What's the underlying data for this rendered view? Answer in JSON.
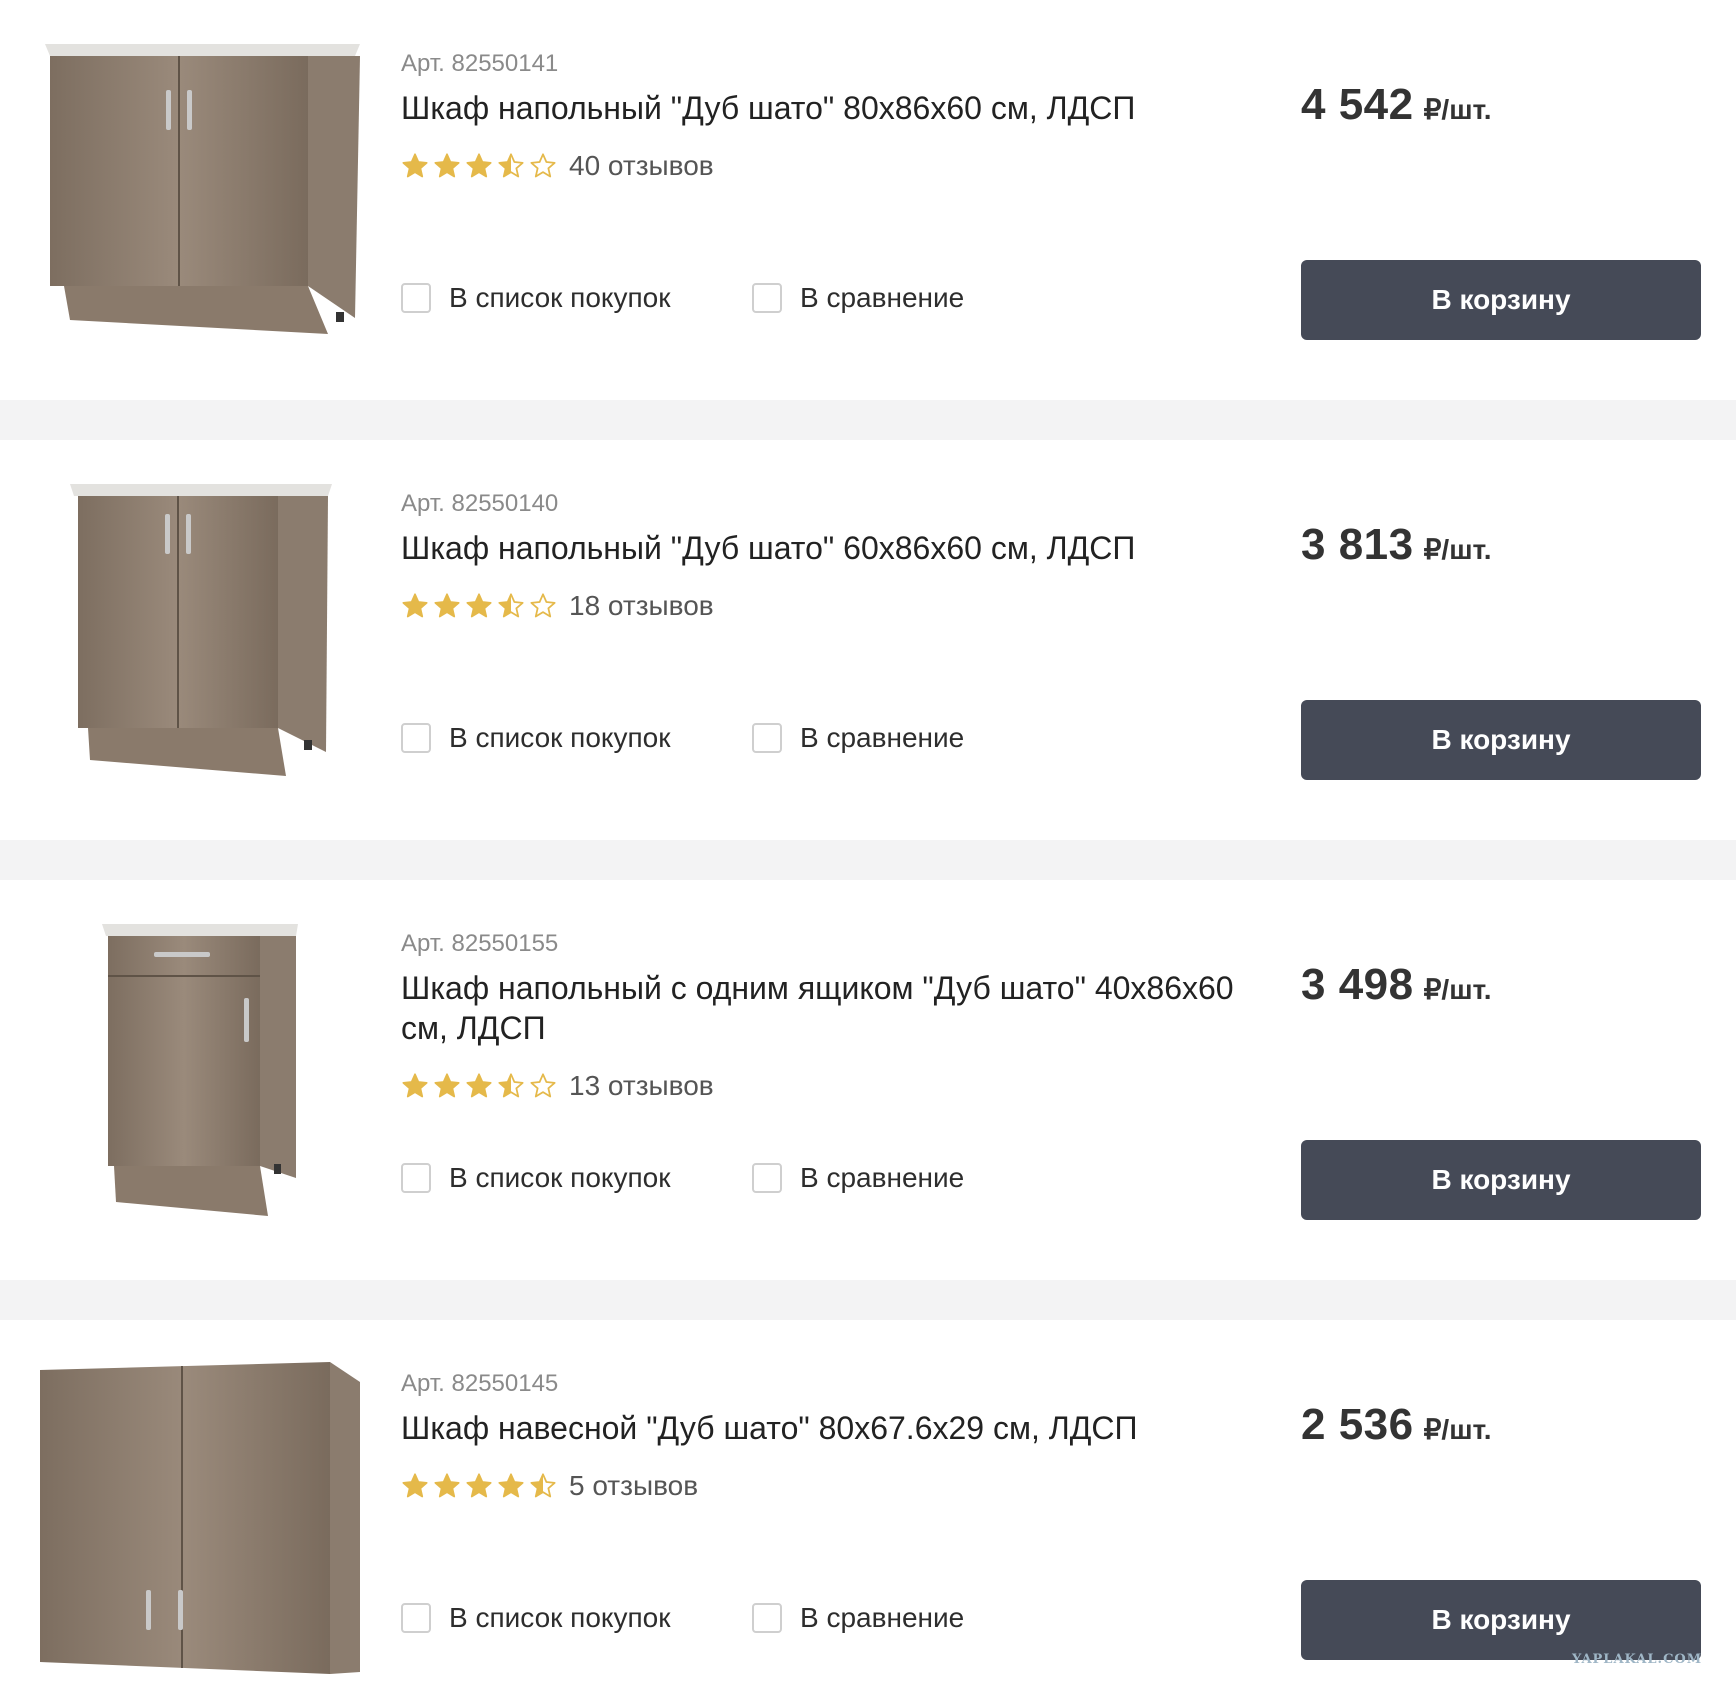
{
  "colors": {
    "page_background": "#f3f3f4",
    "card_background": "#ffffff",
    "button_background": "#454a57",
    "button_text": "#ffffff",
    "star_filled": "#e5b94a",
    "star_empty_outline": "#e5b94a",
    "sku_text": "#8a8a8a"
  },
  "products": [
    {
      "sku": "Арт. 82550141",
      "title": "Шкаф напольный \"Дуб шато\" 80x86x60 см, ЛДСП",
      "rating": 3.5,
      "reviews": "40 отзывов",
      "price": "4 542",
      "price_unit": "₽/шт.",
      "shopping_list_label": "В список покупок",
      "compare_label": "В сравнение",
      "cart_label": "В корзину",
      "image_icon": "floor-cabinet-two-doors"
    },
    {
      "sku": "Арт. 82550140",
      "title": "Шкаф напольный \"Дуб шато\" 60x86x60 см, ЛДСП",
      "rating": 3.5,
      "reviews": "18 отзывов",
      "price": "3 813",
      "price_unit": "₽/шт.",
      "shopping_list_label": "В список покупок",
      "compare_label": "В сравнение",
      "cart_label": "В корзину",
      "image_icon": "floor-cabinet-two-doors"
    },
    {
      "sku": "Арт. 82550155",
      "title": "Шкаф напольный с одним ящиком \"Дуб шато\" 40x86x60 см, ЛДСП",
      "rating": 3.5,
      "reviews": "13 отзывов",
      "price": "3 498",
      "price_unit": "₽/шт.",
      "shopping_list_label": "В список покупок",
      "compare_label": "В сравнение",
      "cart_label": "В корзину",
      "image_icon": "floor-cabinet-drawer"
    },
    {
      "sku": "Арт. 82550145",
      "title": "Шкаф навесной \"Дуб шато\" 80x67.6x29 см, ЛДСП",
      "rating": 4.5,
      "reviews": "5 отзывов",
      "price": "2 536",
      "price_unit": "₽/шт.",
      "shopping_list_label": "В список покупок",
      "compare_label": "В сравнение",
      "cart_label": "В корзину",
      "image_icon": "wall-cabinet"
    }
  ],
  "watermark": "YAPLAKAL.COM"
}
